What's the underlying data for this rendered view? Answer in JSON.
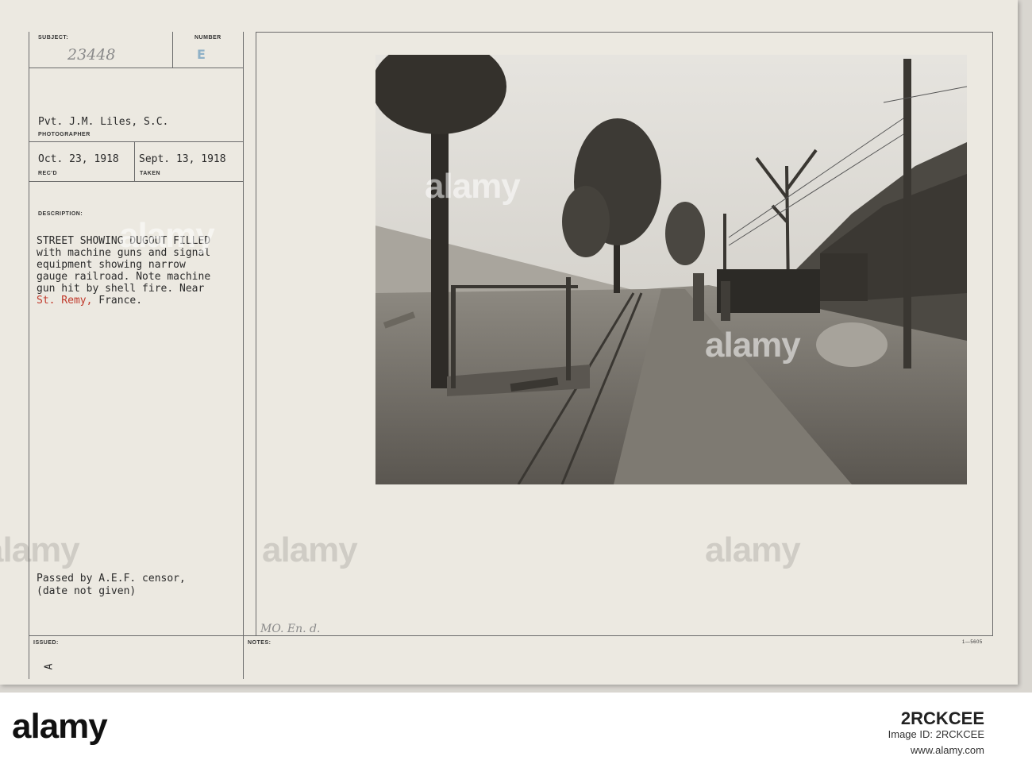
{
  "header": {
    "subject_label": "SUBJECT:",
    "subject_value": "23448",
    "number_label": "NUMBER",
    "number_value": "E"
  },
  "photographer": {
    "name": "Pvt. J.M. Liles, S.C.",
    "label": "PHOTOGRAPHER"
  },
  "dates": {
    "received": "Oct. 23, 1918",
    "received_label": "REC'D",
    "taken": "Sept. 13, 1918",
    "taken_label": "TAKEN"
  },
  "description": {
    "label": "DESCRIPTION:",
    "lines": [
      "STREET SHOWING DUGOUT FILLED",
      "with machine guns and signal",
      "equipment showing narrow",
      "gauge railroad. Note machine",
      "gun hit by shell fire. Near"
    ],
    "place": "St. Remy,",
    "country": " France."
  },
  "censor": {
    "line1": "Passed by A.E.F. censor,",
    "line2": "(date not given)"
  },
  "footer": {
    "issued_label": "ISSUED:",
    "issued_mark": "A",
    "notes_label": "NOTES:",
    "handwritten_note": "MO. En. d.",
    "form_code": "1—5605"
  },
  "watermark": {
    "text": "alamy"
  },
  "stock_banner": {
    "logo": "alamy",
    "image_id_label": "Image ID: 2RCKCEE",
    "url": "www.alamy.com",
    "code": "2RCKCEE"
  },
  "colors": {
    "card": "#ece9e1",
    "ink": "#2a2a2a",
    "red_ink": "#c0392b",
    "stamp_blue": "#8fb1c7"
  }
}
